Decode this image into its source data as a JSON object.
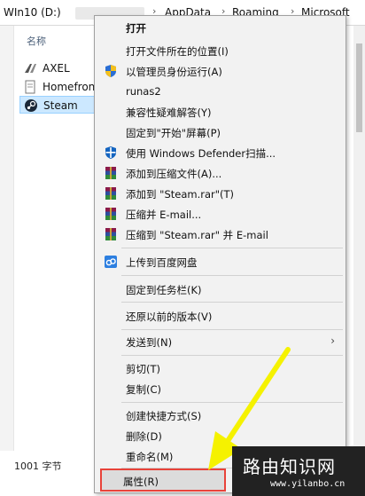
{
  "breadcrumb": {
    "drive": "WIn10 (D:)",
    "parts": [
      "AppData",
      "Roaming",
      "Microsoft"
    ]
  },
  "file_list": {
    "column_header": "名称",
    "items": [
      {
        "name": "AXEL",
        "icon": "app-icon"
      },
      {
        "name": "Homefron",
        "icon": "document-icon"
      },
      {
        "name": "Steam",
        "icon": "steam-icon"
      }
    ]
  },
  "status": {
    "size_text": "1001 字节"
  },
  "context_menu": {
    "items": [
      {
        "label": "打开"
      },
      {
        "label": "打开文件所在的位置(I)"
      },
      {
        "label": "以管理员身份运行(A)",
        "icon": "shield-icon"
      },
      {
        "label": "runas2"
      },
      {
        "label": "兼容性疑难解答(Y)"
      },
      {
        "label": "固定到\"开始\"屏幕(P)"
      },
      {
        "label": "使用 Windows Defender扫描...",
        "icon": "defender-icon"
      },
      {
        "label": "添加到压缩文件(A)...",
        "icon": "winrar-icon"
      },
      {
        "label": "添加到 \"Steam.rar\"(T)",
        "icon": "winrar-icon"
      },
      {
        "label": "压缩并 E-mail...",
        "icon": "winrar-icon"
      },
      {
        "label": "压缩到 \"Steam.rar\" 并 E-mail",
        "icon": "winrar-icon"
      },
      {
        "label": "上传到百度网盘",
        "icon": "baidu-cloud-icon"
      },
      {
        "label": "固定到任务栏(K)"
      },
      {
        "label": "还原以前的版本(V)"
      },
      {
        "label": "发送到(N)"
      },
      {
        "label": "剪切(T)"
      },
      {
        "label": "复制(C)"
      },
      {
        "label": "创建快捷方式(S)"
      },
      {
        "label": "删除(D)"
      },
      {
        "label": "重命名(M)"
      },
      {
        "label": "属性(R)"
      }
    ]
  },
  "watermark": {
    "title": "路由知识网",
    "url": "www.yilanbo.cn"
  },
  "colors": {
    "highlight_border": "#e8433a",
    "annotation_arrow": "#f5f200",
    "selection": "#cce8ff"
  }
}
